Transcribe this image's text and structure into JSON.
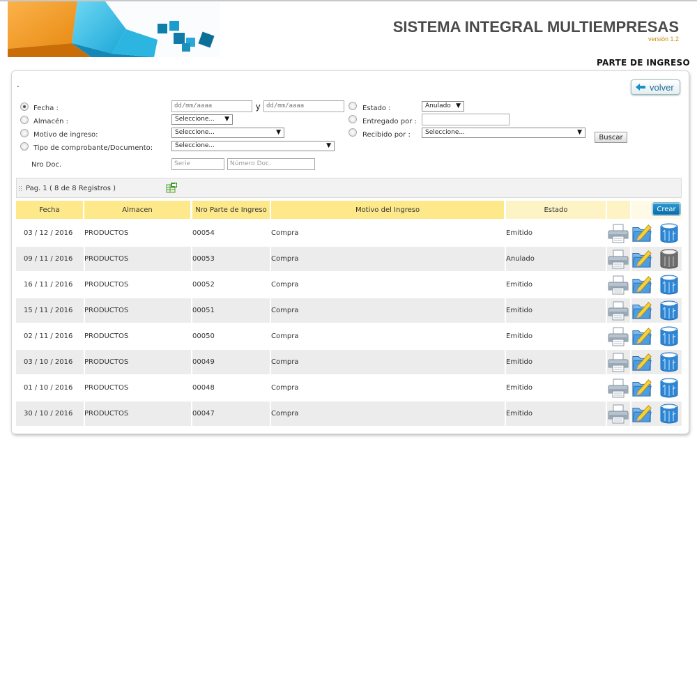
{
  "header": {
    "system_title": "SISTEMA INTEGRAL MULTIEMPRESAS",
    "version": "versión 1.2",
    "page_title": "PARTE DE INGRESO",
    "dash": "-"
  },
  "toolbar": {
    "volver_label": "volver"
  },
  "filters": {
    "fecha_label": "Fecha :",
    "almacen_label": "Almacén :",
    "motivo_label": "Motivo de ingreso:",
    "tipo_label": "Tipo de comprobante/Documento:",
    "nro_doc_label": "Nro Doc.",
    "estado_label": "Estado :",
    "entregado_label": "Entregado por :",
    "recibido_label": "Recibido por :",
    "date_from_placeholder": "dd/mm/aaaa",
    "date_to_placeholder": "dd/mm/aaaa",
    "date_separator": "y",
    "almacen_value": "Seleccione...",
    "motivo_value": "Seleccione...",
    "tipo_value": "Seleccione...",
    "estado_value": "Anulado",
    "recibido_value": "Seleccione...",
    "entregado_value": "",
    "serie_placeholder": "Serie",
    "numero_placeholder": "Número Doc.",
    "selected_radio": "fecha",
    "buscar_label": "Buscar"
  },
  "pager": {
    "text": "Pag. 1 ( 8 de 8 Registros )"
  },
  "table": {
    "columns": [
      "Fecha",
      "Almacen",
      "Nro Parte de Ingreso",
      "Motivo del Ingreso",
      "Estado"
    ],
    "crear_label": "Crear",
    "rows": [
      {
        "fecha": "03 / 12 / 2016",
        "almacen": "PRODUCTOS",
        "nro": "00054",
        "motivo": "Compra",
        "estado": "Emitido"
      },
      {
        "fecha": "09 / 11 / 2016",
        "almacen": "PRODUCTOS",
        "nro": "00053",
        "motivo": "Compra",
        "estado": "Anulado"
      },
      {
        "fecha": "16 / 11 / 2016",
        "almacen": "PRODUCTOS",
        "nro": "00052",
        "motivo": "Compra",
        "estado": "Emitido"
      },
      {
        "fecha": "15 / 11 / 2016",
        "almacen": "PRODUCTOS",
        "nro": "00051",
        "motivo": "Compra",
        "estado": "Emitido"
      },
      {
        "fecha": "02 / 11 / 2016",
        "almacen": "PRODUCTOS",
        "nro": "00050",
        "motivo": "Compra",
        "estado": "Emitido"
      },
      {
        "fecha": "03 / 10 / 2016",
        "almacen": "PRODUCTOS",
        "nro": "00049",
        "motivo": "Compra",
        "estado": "Emitido"
      },
      {
        "fecha": "01 / 10 / 2016",
        "almacen": "PRODUCTOS",
        "nro": "00048",
        "motivo": "Compra",
        "estado": "Emitido"
      },
      {
        "fecha": "30 / 10 / 2016",
        "almacen": "PRODUCTOS",
        "nro": "00047",
        "motivo": "Compra",
        "estado": "Emitido"
      }
    ]
  },
  "icons": {
    "print": "printer-icon",
    "edit": "folder-edit-icon",
    "delete": "trash-icon",
    "export": "excel-export-icon",
    "back": "arrow-left-icon"
  },
  "colors": {
    "header_yellow": "#fde98a",
    "row_alt": "#ececec",
    "crear_blue": "#0a6aa6",
    "title_gray": "#4a4a4a",
    "version_orange": "#c98a10"
  }
}
